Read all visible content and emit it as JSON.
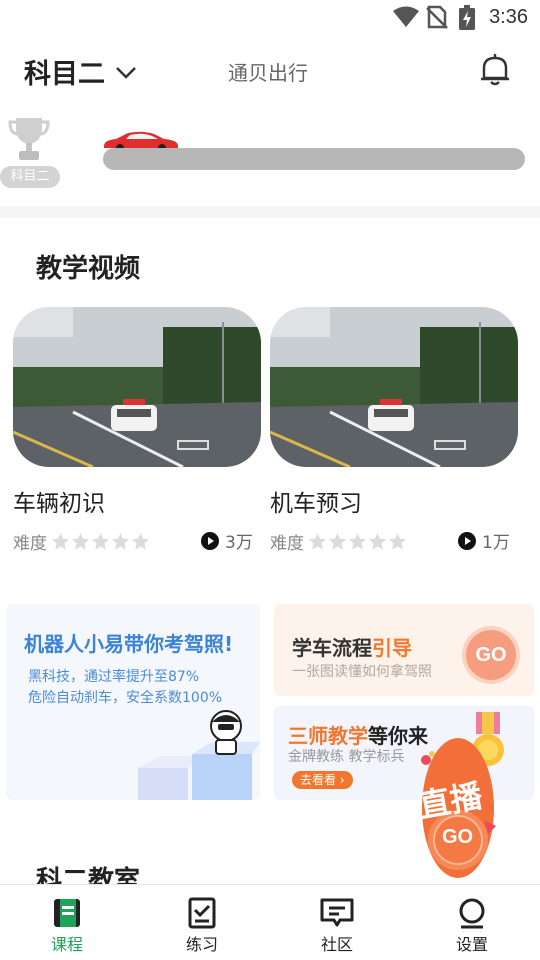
{
  "status_bar": {
    "time": "3:36"
  },
  "header": {
    "subject": "科目二",
    "brand": "通贝出行"
  },
  "progress": {
    "badge": "科目二",
    "value": 0
  },
  "teaching_videos": {
    "title": "教学视频",
    "items": [
      {
        "title": "车辆初识",
        "difficulty_label": "难度",
        "stars": 0,
        "views": "3万"
      },
      {
        "title": "机车预习",
        "difficulty_label": "难度",
        "stars": 0,
        "views": "1万"
      }
    ]
  },
  "banners": {
    "robot": {
      "title": "机器人小易带你考驾照!",
      "line1": "黑科技，通过率提升至87%",
      "line2": "危险自动刹车，安全系数100%"
    },
    "process": {
      "title_a": "学车流程",
      "title_b": "引导",
      "subtitle": "一张图读懂如何拿驾照",
      "go": "GO"
    },
    "teachers": {
      "title_a": "三师教学",
      "title_b": "等你来",
      "subtitle": "金牌教练  教学标兵",
      "cta": "去看看 ›"
    },
    "live": {
      "label": "直播",
      "go": "GO"
    }
  },
  "section2_title": "科二教室",
  "tabs": [
    {
      "label": "课程",
      "icon": "course-icon",
      "active": true
    },
    {
      "label": "练习",
      "icon": "practice-icon",
      "active": false
    },
    {
      "label": "社区",
      "icon": "community-icon",
      "active": false
    },
    {
      "label": "设置",
      "icon": "settings-icon",
      "active": false
    }
  ],
  "colors": {
    "accent_green": "#1fa35a",
    "accent_orange": "#f2772e",
    "link_blue": "#3c82d6"
  }
}
